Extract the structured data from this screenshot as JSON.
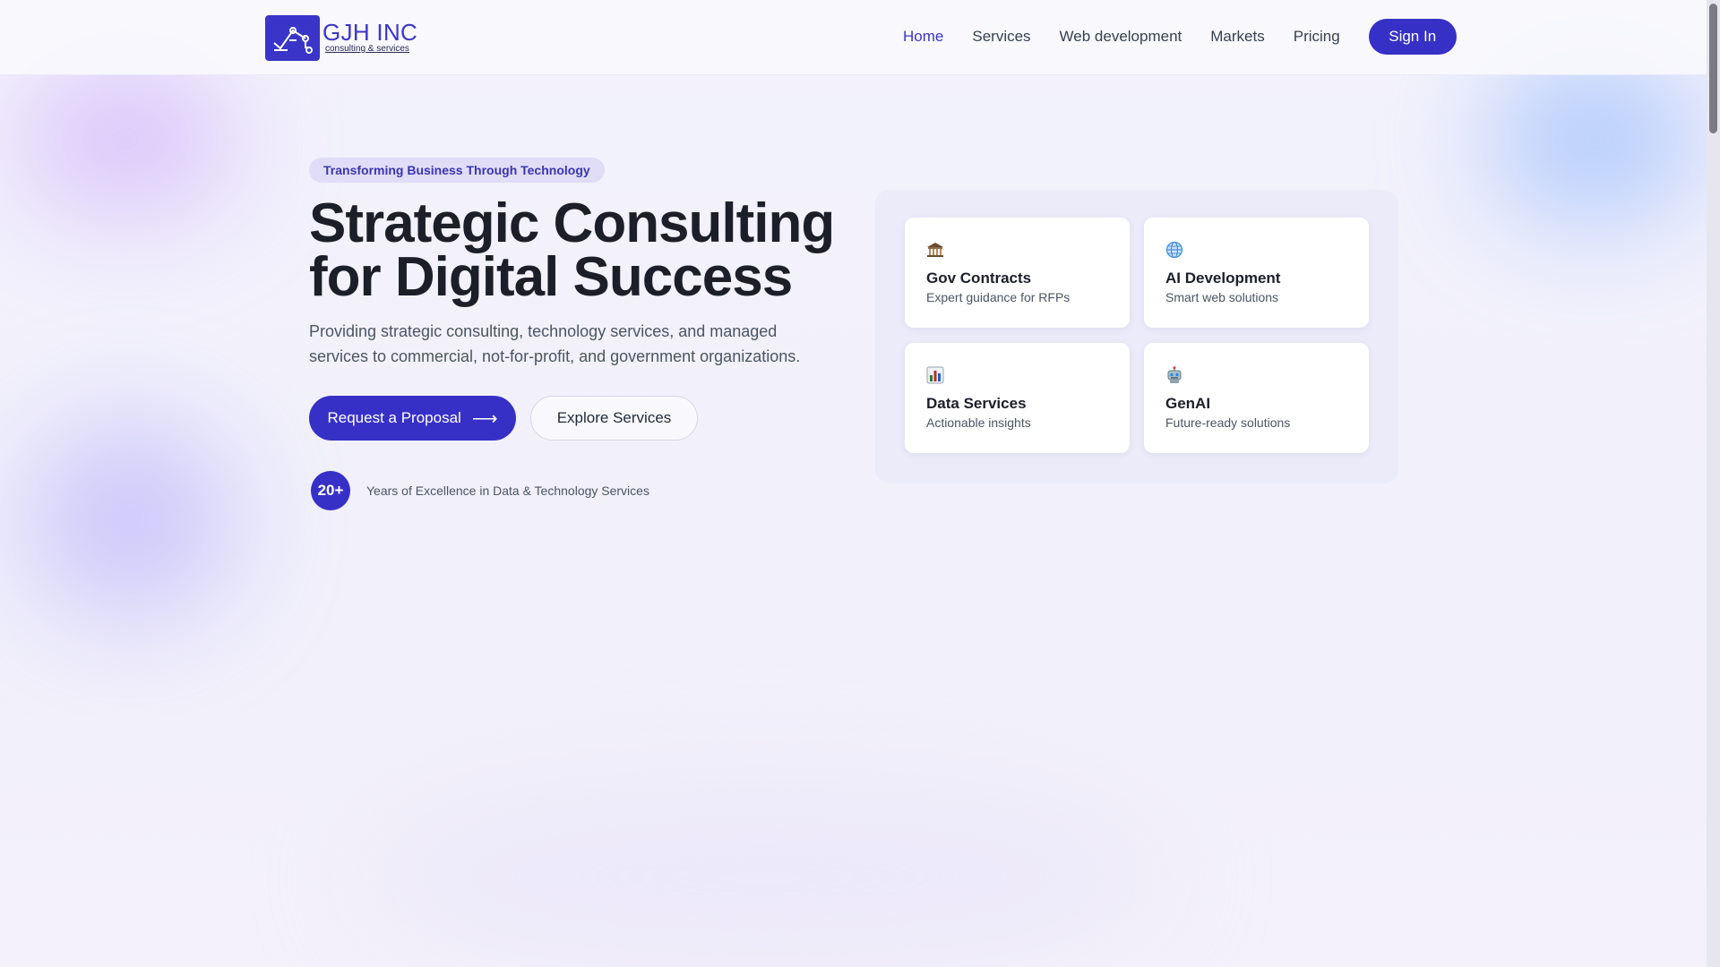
{
  "brand": {
    "name": "GJH INC",
    "tagline": "consulting & services",
    "accent": "#3730c6"
  },
  "nav": {
    "items": [
      {
        "label": "Home",
        "active": true
      },
      {
        "label": "Services"
      },
      {
        "label": "Web development"
      },
      {
        "label": "Markets"
      },
      {
        "label": "Pricing"
      }
    ],
    "signin_label": "Sign In"
  },
  "hero": {
    "eyebrow": "Transforming Business Through Technology",
    "title_line1": "Strategic Consulting",
    "title_line2": "for Digital Success",
    "subtitle": "Providing strategic consulting, technology services, and managed services to commercial, not-for-profit, and government organizations.",
    "primary_cta": "Request a Proposal",
    "primary_cta_icon": "arrow-right-icon",
    "secondary_cta": "Explore Services",
    "stat_value": "20+",
    "stat_label": "Years of Excellence in Data & Technology Services"
  },
  "cards": [
    {
      "icon": "government-building-icon",
      "title": "Gov Contracts",
      "desc": "Expert guidance for RFPs"
    },
    {
      "icon": "globe-icon",
      "title": "AI Development",
      "desc": "Smart web solutions"
    },
    {
      "icon": "bar-chart-icon",
      "title": "Data Services",
      "desc": "Actionable insights"
    },
    {
      "icon": "robot-icon",
      "title": "GenAI",
      "desc": "Future-ready solutions"
    }
  ]
}
